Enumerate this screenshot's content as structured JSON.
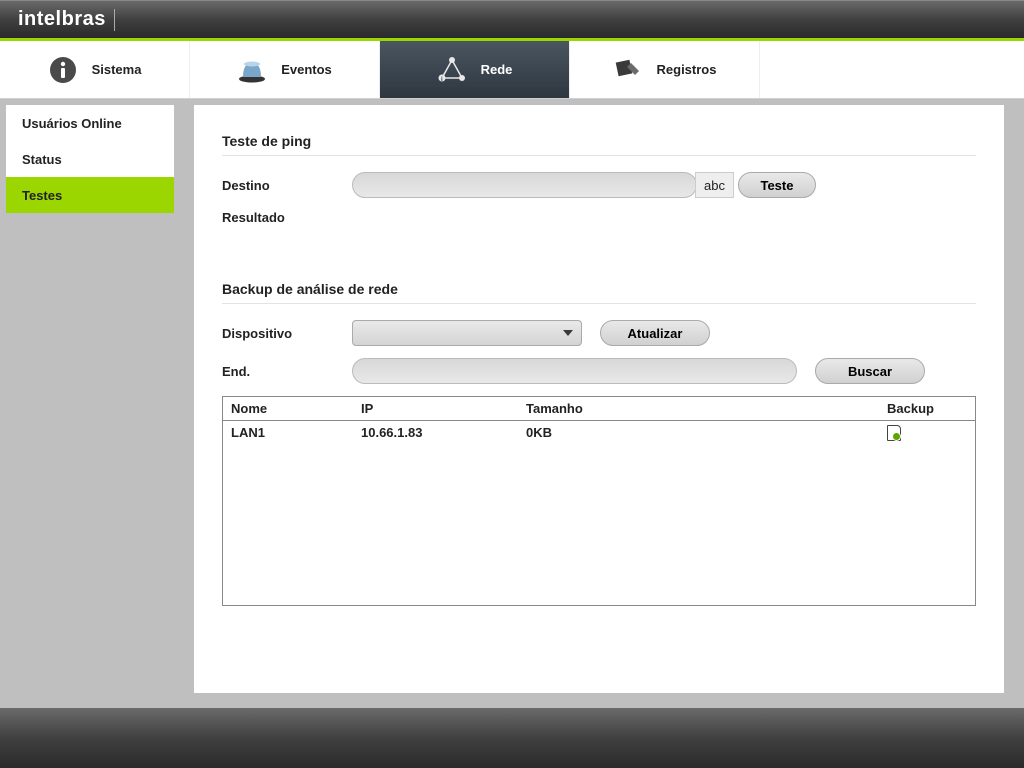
{
  "brand": "intelbras",
  "nav": {
    "sistema": "Sistema",
    "eventos": "Eventos",
    "rede": "Rede",
    "registros": "Registros"
  },
  "sidebar": {
    "items": [
      {
        "label": "Usuários Online"
      },
      {
        "label": "Status"
      },
      {
        "label": "Testes"
      }
    ]
  },
  "ping": {
    "section_title": "Teste de ping",
    "destino_label": "Destino",
    "destino_value": "",
    "abc_hint": "abc",
    "teste_button": "Teste",
    "resultado_label": "Resultado"
  },
  "backup": {
    "section_title": "Backup de análise de rede",
    "dispositivo_label": "Dispositivo",
    "dispositivo_value": "",
    "atualizar_button": "Atualizar",
    "end_label": "End.",
    "end_value": "",
    "buscar_button": "Buscar"
  },
  "table": {
    "headers": {
      "nome": "Nome",
      "ip": "IP",
      "tamanho": "Tamanho",
      "backup": "Backup"
    },
    "rows": [
      {
        "nome": "LAN1",
        "ip": "10.66.1.83",
        "tamanho": "0KB"
      }
    ]
  }
}
